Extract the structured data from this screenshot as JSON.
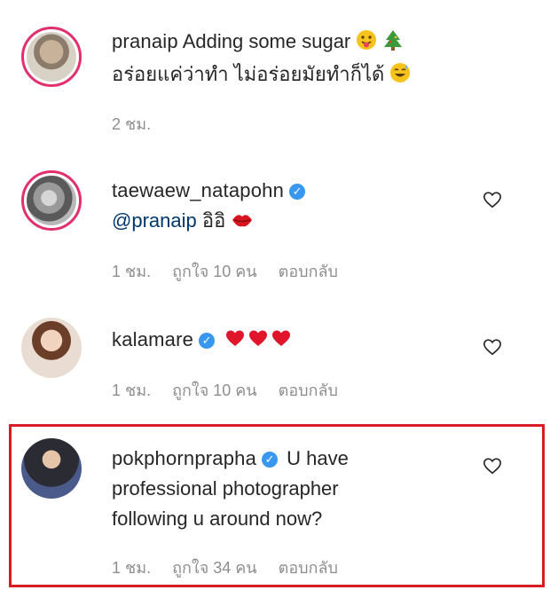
{
  "comments": [
    {
      "username": "pranaip",
      "verified": false,
      "line1": "Adding some sugar",
      "line2": "อร่อยแค่ว่าทำ ไม่อร่อยมัยทำก็ได้",
      "time": "2 ชม.",
      "likes": "",
      "reply": ""
    },
    {
      "username": "taewaew_natapohn",
      "verified": true,
      "mention": "@pranaip",
      "text": "อิอิ",
      "time": "1 ชม.",
      "likes": "ถูกใจ 10 คน",
      "reply": "ตอบกลับ"
    },
    {
      "username": "kalamare",
      "verified": true,
      "text": "",
      "time": "1 ชม.",
      "likes": "ถูกใจ 10 คน",
      "reply": "ตอบกลับ"
    },
    {
      "username": "pokphornprapha",
      "verified": true,
      "text_line1": "U have",
      "text_line2": "professional photographer",
      "text_line3": "following u around now?",
      "time": "1 ชม.",
      "likes": "ถูกใจ 34 คน",
      "reply": "ตอบกลับ"
    }
  ],
  "colors": {
    "verified": "#3897f0",
    "highlight": "#d91c24",
    "heart": "#e0152b",
    "meta": "#8e8e8e"
  }
}
